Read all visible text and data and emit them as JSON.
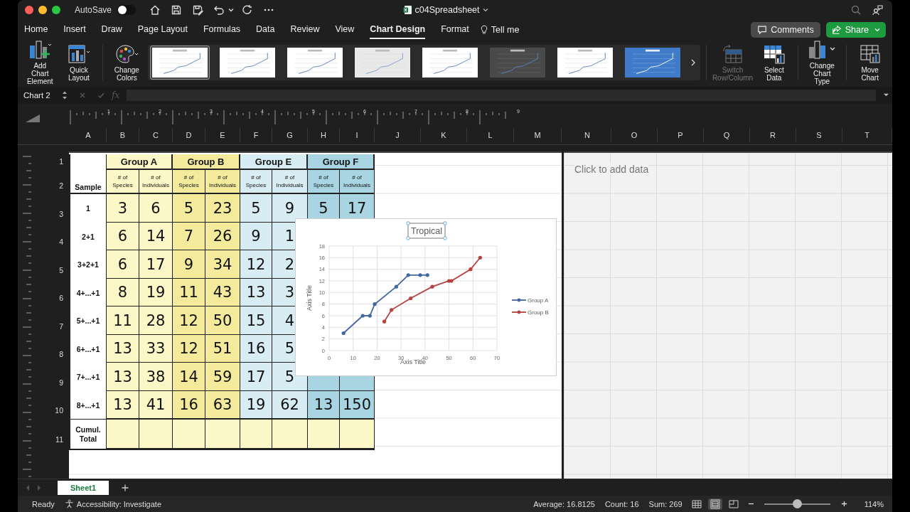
{
  "window": {
    "title": "c04Spreadsheet",
    "autosave": {
      "label": "AutoSave",
      "on": false
    }
  },
  "ribbon_tabs": [
    {
      "label": "Home",
      "selected": false
    },
    {
      "label": "Insert",
      "selected": false
    },
    {
      "label": "Draw",
      "selected": false
    },
    {
      "label": "Page Layout",
      "selected": false
    },
    {
      "label": "Formulas",
      "selected": false
    },
    {
      "label": "Data",
      "selected": false
    },
    {
      "label": "Review",
      "selected": false
    },
    {
      "label": "View",
      "selected": false
    },
    {
      "label": "Chart Design",
      "selected": true
    },
    {
      "label": "Format",
      "selected": false
    }
  ],
  "tell_me": "Tell me",
  "comments_button": "Comments",
  "share_button": "Share",
  "ribbon_left": [
    {
      "kind": "add-element",
      "label": "Add Chart Element",
      "disabled": false
    },
    {
      "kind": "quick-layout",
      "label": "Quick Layout",
      "disabled": false
    },
    {
      "kind": "colors",
      "label": "Change Colors",
      "disabled": false
    }
  ],
  "chart_styles": [
    {
      "kind": "light",
      "selected": true
    },
    {
      "kind": "light",
      "selected": false
    },
    {
      "kind": "light",
      "selected": false
    },
    {
      "kind": "gray",
      "selected": false
    },
    {
      "kind": "light",
      "selected": false
    },
    {
      "kind": "dark",
      "selected": false
    },
    {
      "kind": "light",
      "selected": false
    },
    {
      "kind": "blue",
      "selected": false
    }
  ],
  "ribbon_right": [
    {
      "kind": "switch",
      "label": "Switch Row/Column",
      "disabled": true
    },
    {
      "kind": "select-data",
      "label": "Select Data",
      "disabled": false
    },
    {
      "kind": "chart-type",
      "label": "Change Chart Type",
      "disabled": false
    },
    {
      "kind": "move",
      "label": "Move Chart",
      "disabled": false
    }
  ],
  "formula_bar": {
    "name_box": "Chart 2",
    "fx": "fx"
  },
  "ruler": [
    "1",
    "2",
    "3",
    "4",
    "5",
    "6",
    "7",
    "8",
    "9"
  ],
  "columns": [
    "A",
    "B",
    "C",
    "D",
    "E",
    "F",
    "G",
    "H",
    "I",
    "J",
    "K",
    "L",
    "M"
  ],
  "columns_right": [
    "N",
    "O",
    "P",
    "Q",
    "R",
    "S",
    "T"
  ],
  "row_numbers": [
    "1",
    "2",
    "3",
    "4",
    "5",
    "6",
    "7",
    "8",
    "9",
    "10",
    "11"
  ],
  "table": {
    "sample_heading": "Sample",
    "groups": [
      {
        "name": "Group A",
        "color": "#fcf7c6"
      },
      {
        "name": "Group B",
        "color": "#f3ea9c"
      },
      {
        "name": "Group E",
        "color": "#d8edf3"
      },
      {
        "name": "Group F",
        "color": "#a8d5e1"
      }
    ],
    "subheaders": [
      "# of Species",
      "# of Individuals",
      "# of Species",
      "# of Individuals",
      "# of Species",
      "# of Individuals",
      "# of Species",
      "# of Individuals"
    ],
    "rows": [
      {
        "sample": "1",
        "cells": [
          "3",
          "6",
          "5",
          "23",
          "5",
          "9",
          "5",
          "17"
        ]
      },
      {
        "sample": "2+1",
        "cells": [
          "6",
          "14",
          "7",
          "26",
          "9",
          "1",
          null,
          null
        ]
      },
      {
        "sample": "3+2+1",
        "cells": [
          "6",
          "17",
          "9",
          "34",
          "12",
          "2",
          null,
          null
        ]
      },
      {
        "sample": "4+...+1",
        "cells": [
          "8",
          "19",
          "11",
          "43",
          "13",
          "3",
          null,
          null
        ]
      },
      {
        "sample": "5+...+1",
        "cells": [
          "11",
          "28",
          "12",
          "50",
          "15",
          "4",
          null,
          null
        ]
      },
      {
        "sample": "6+...+1",
        "cells": [
          "13",
          "33",
          "12",
          "51",
          "16",
          "5",
          null,
          null
        ]
      },
      {
        "sample": "7+...+1",
        "cells": [
          "13",
          "38",
          "14",
          "59",
          "17",
          "5",
          null,
          null
        ]
      },
      {
        "sample": "8+...+1",
        "cells": [
          "13",
          "41",
          "16",
          "63",
          "19",
          "62",
          "13",
          "150"
        ]
      }
    ],
    "total_label": "Cumul. Total"
  },
  "chart": {
    "chart_data": {
      "type": "line",
      "grid": true,
      "legend": "right",
      "title": "Tropical",
      "xlabel": "Axis Title",
      "ylabel": "Axis Title",
      "xlim": [
        0,
        70
      ],
      "ylim": [
        0,
        18
      ],
      "xticks": [
        {
          "value": 0,
          "label": "0"
        },
        {
          "value": 10,
          "label": "10"
        },
        {
          "value": 20,
          "label": "20"
        },
        {
          "value": 30,
          "label": "30"
        },
        {
          "value": 40,
          "label": "40"
        },
        {
          "value": 50,
          "label": "50"
        },
        {
          "value": 60,
          "label": "60"
        },
        {
          "value": 70,
          "label": "70"
        }
      ],
      "yticks": [
        {
          "value": 0,
          "label": "0"
        },
        {
          "value": 2,
          "label": "2"
        },
        {
          "value": 4,
          "label": "4"
        },
        {
          "value": 6,
          "label": "6"
        },
        {
          "value": 8,
          "label": "8"
        },
        {
          "value": 10,
          "label": "10"
        },
        {
          "value": 12,
          "label": "12"
        },
        {
          "value": 14,
          "label": "14"
        },
        {
          "value": 16,
          "label": "16"
        },
        {
          "value": 18,
          "label": "18"
        }
      ],
      "series": [
        {
          "name": "Group A",
          "color": "#41689f",
          "x": [
            6,
            14,
            17,
            19,
            28,
            33,
            38,
            41
          ],
          "values": [
            3,
            6,
            6,
            8,
            11,
            13,
            13,
            13
          ]
        },
        {
          "name": "Group B",
          "color": "#b8403f",
          "x": [
            23,
            26,
            34,
            43,
            50,
            51,
            59,
            63
          ],
          "values": [
            5,
            7,
            9,
            11,
            12,
            12,
            14,
            16
          ]
        }
      ]
    }
  },
  "right_page": {
    "hint": "Click to add data"
  },
  "sheets": [
    {
      "name": "Sheet1",
      "selected": true
    }
  ],
  "status_bar": {
    "ready": "Ready",
    "accessibility": "Accessibility: Investigate",
    "average": "Average: 16.8125",
    "count": "Count: 16",
    "sum": "Sum: 269",
    "views": [
      {
        "kind": "normal",
        "selected": false
      },
      {
        "kind": "page-layout",
        "selected": true
      },
      {
        "kind": "page-break",
        "selected": false
      }
    ],
    "zoom": {
      "level": 0.5,
      "reading": "114%"
    }
  }
}
